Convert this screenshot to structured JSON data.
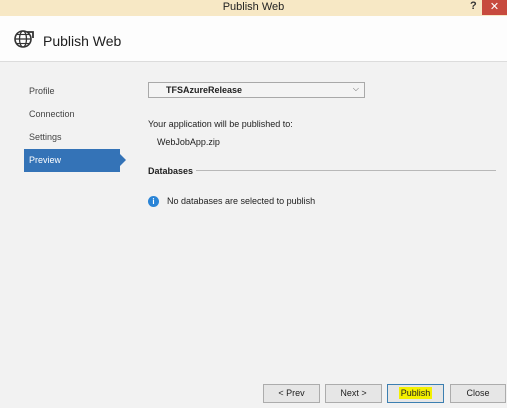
{
  "window": {
    "title": "Publish Web",
    "help_label": "?",
    "close_label": "✕"
  },
  "header": {
    "title": "Publish Web",
    "icon": "globe-publish-icon"
  },
  "sidebar": {
    "items": [
      {
        "label": "Profile",
        "active": false
      },
      {
        "label": "Connection",
        "active": false
      },
      {
        "label": "Settings",
        "active": false
      },
      {
        "label": "Preview",
        "active": true
      }
    ]
  },
  "main": {
    "profile_select": {
      "value": "TFSAzureRelease"
    },
    "publish_target_label": "Your application will be published to:",
    "publish_target_value": "WebJobApp.zip",
    "databases_title": "Databases",
    "databases_message": "No databases are selected to publish"
  },
  "footer": {
    "prev_label": "< Prev",
    "next_label": "Next >",
    "publish_label": "Publish",
    "close_label": "Close"
  },
  "colors": {
    "accent": "#3473b7",
    "title_bar": "#f7e8c5",
    "close_button": "#c74a3e",
    "publish_highlight": "#f3f000"
  }
}
